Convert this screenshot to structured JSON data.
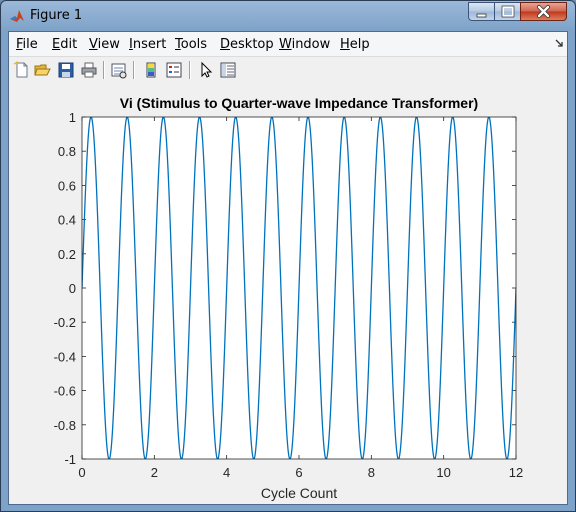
{
  "window": {
    "title": "Figure 1"
  },
  "menubar": {
    "items": [
      {
        "label": "File",
        "accel": "F",
        "rest": "ile"
      },
      {
        "label": "Edit",
        "accel": "E",
        "rest": "dit"
      },
      {
        "label": "View",
        "accel": "V",
        "rest": "iew"
      },
      {
        "label": "Insert",
        "accel": "I",
        "rest": "nsert"
      },
      {
        "label": "Tools",
        "accel": "T",
        "rest": "ools"
      },
      {
        "label": "Desktop",
        "accel": "D",
        "rest": "esktop"
      },
      {
        "label": "Window",
        "accel": "W",
        "rest": "indow"
      },
      {
        "label": "Help",
        "accel": "H",
        "rest": "elp"
      }
    ]
  },
  "toolbar": {
    "buttons": [
      {
        "icon": "new-figure-icon"
      },
      {
        "icon": "open-file-icon"
      },
      {
        "icon": "save-icon"
      },
      {
        "icon": "print-icon"
      },
      {
        "icon": "link-plot-icon"
      },
      {
        "icon": "insert-colorbar-icon"
      },
      {
        "icon": "insert-legend-icon"
      },
      {
        "icon": "edit-plot-arrow-icon"
      },
      {
        "icon": "property-editor-icon"
      }
    ]
  },
  "colors": {
    "line": "#0072BD",
    "axes_bg": "#ffffff",
    "figure_bg": "#f0f0f0"
  },
  "chart_data": {
    "type": "line",
    "title": "Vi (Stimulus to Quarter-wave Impedance Transformer)",
    "xlabel": "Cycle Count",
    "ylabel": "",
    "xlim": [
      0,
      12
    ],
    "ylim": [
      -1,
      1
    ],
    "xticks": [
      "0",
      "2",
      "4",
      "6",
      "8",
      "10",
      "12"
    ],
    "yticks": [
      "1",
      "0.8",
      "0.6",
      "0.4",
      "0.2",
      "0",
      "-0.2",
      "-0.4",
      "-0.6",
      "-0.8",
      "-1"
    ],
    "series": [
      {
        "function": "sin(2*pi*x)",
        "x_start": 0,
        "x_end": 12,
        "cycles": 12,
        "amplitude": 1
      }
    ],
    "grid": false
  }
}
